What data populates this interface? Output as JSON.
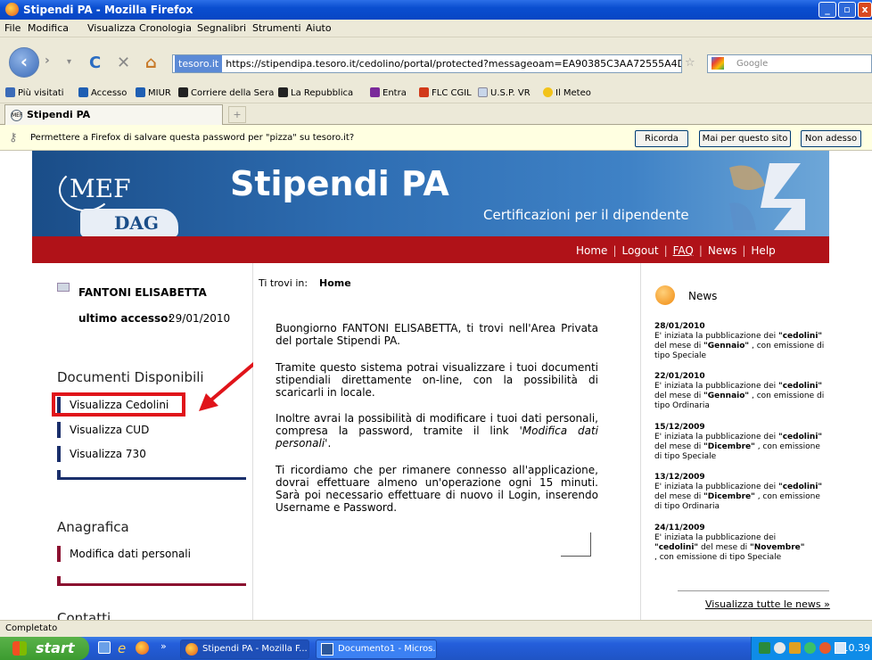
{
  "window": {
    "title": "Stipendi PA - Mozilla Firefox"
  },
  "menu": [
    "File",
    "Modifica",
    "Visualizza",
    "Cronologia",
    "Segnalibri",
    "Strumenti",
    "Aiuto"
  ],
  "address": {
    "site_badge": "tesoro.it",
    "url": "https://stipendipa.tesoro.it/cedolino/portal/protected?messageoam=EA90385C3AA72555A4D260B6E27",
    "search_placeholder": "Google"
  },
  "bookmarks": [
    {
      "label": "Più visitati",
      "color": "#3b6bb8"
    },
    {
      "label": "Accesso",
      "color": "#1f5fb3"
    },
    {
      "label": "MIUR",
      "color": "#1f5fb3"
    },
    {
      "label": "Corriere della Sera",
      "color": "#222222"
    },
    {
      "label": "La Repubblica",
      "color": "#222222"
    },
    {
      "label": "Entra",
      "color": "#7a2a9a"
    },
    {
      "label": "FLC CGIL",
      "color": "#d23a1a"
    },
    {
      "label": "U.S.P. VR",
      "color": "#c8d6ea"
    },
    {
      "label": "Il Meteo",
      "color": "#f2c31a"
    }
  ],
  "tab": {
    "label": "Stipendi PA"
  },
  "notification": {
    "message": "Permettere a Firefox di salvare questa password per \"pizza\" su tesoro.it?",
    "buttons": [
      "Ricorda",
      "Mai per questo sito",
      "Non adesso"
    ]
  },
  "site": {
    "logo_main": "MEF",
    "logo_sub": "DAG",
    "title": "Stipendi PA",
    "subtitle": "Certificazioni per il dipendente",
    "nav": [
      "Home",
      "Logout",
      "FAQ",
      "News",
      "Help"
    ]
  },
  "user": {
    "name": "FANTONI ELISABETTA",
    "last_access_label": "ultimo accesso:",
    "last_access": "29/01/2010"
  },
  "sidebar": {
    "documents_heading": "Documenti Disponibili",
    "documents": [
      "Visualizza Cedolini",
      "Visualizza CUD",
      "Visualizza 730"
    ],
    "registry_heading": "Anagrafica",
    "registry": [
      "Modifica dati personali"
    ],
    "contacts_heading": "Contatti"
  },
  "breadcrumb": {
    "label": "Ti trovi in:",
    "current": "Home"
  },
  "content": {
    "p1": "Buongiorno FANTONI ELISABETTA, ti trovi nell'Area Privata del portale Stipendi PA.",
    "p2": "Tramite questo sistema potrai visualizzare i tuoi documenti stipendiali direttamente on-line, con la possibilità di scaricarli in locale.",
    "p3_before": "Inoltre avrai la possibilità di modificare i tuoi dati personali, compresa la password, tramite il link ",
    "p3_link": "'Modifica dati personali'",
    "p3_after": ".",
    "p4": "Ti ricordiamo che per rimanere connesso all'applicazione, dovrai effettuare almeno un'operazione ogni 15 minuti. Sarà poi necessario effettuare di nuovo il Login, inserendo Username e Password."
  },
  "news": {
    "heading": "News",
    "items": [
      {
        "date": "28/01/2010",
        "t1": "E' iniziata la pubblicazione dei ",
        "b1": "\"cedolini\"",
        "t2": " del mese di ",
        "b2": "\"Gennaio\"",
        "t3": " , con emissione di tipo Speciale"
      },
      {
        "date": "22/01/2010",
        "t1": "E' iniziata la pubblicazione dei ",
        "b1": "\"cedolini\"",
        "t2": " del mese di ",
        "b2": "\"Gennaio\"",
        "t3": " , con emissione di tipo Ordinaria"
      },
      {
        "date": "15/12/2009",
        "t1": "E' iniziata la pubblicazione dei ",
        "b1": "\"cedolini\"",
        "t2": " del mese di ",
        "b2": "\"Dicembre\"",
        "t3": " , con emissione di tipo Speciale"
      },
      {
        "date": "13/12/2009",
        "t1": "E' iniziata la pubblicazione dei ",
        "b1": "\"cedolini\"",
        "t2": " del mese di ",
        "b2": "\"Dicembre\"",
        "t3": " , con emissione di tipo Ordinaria"
      },
      {
        "date": "24/11/2009",
        "t1": "E' iniziata la pubblicazione dei ",
        "b1": "\"cedolini\"",
        "t2": " del mese di ",
        "b2": "\"Novembre\"",
        "t3": " , con emissione di tipo Speciale"
      }
    ],
    "all_link": "Visualizza tutte le news »"
  },
  "status": {
    "text": "Completato"
  },
  "taskbar": {
    "start": "start",
    "items": [
      "Stipendi PA - Mozilla F...",
      "Documento1 - Micros..."
    ],
    "clock": "10.39"
  },
  "annotation": {
    "color": "#e0141a"
  }
}
